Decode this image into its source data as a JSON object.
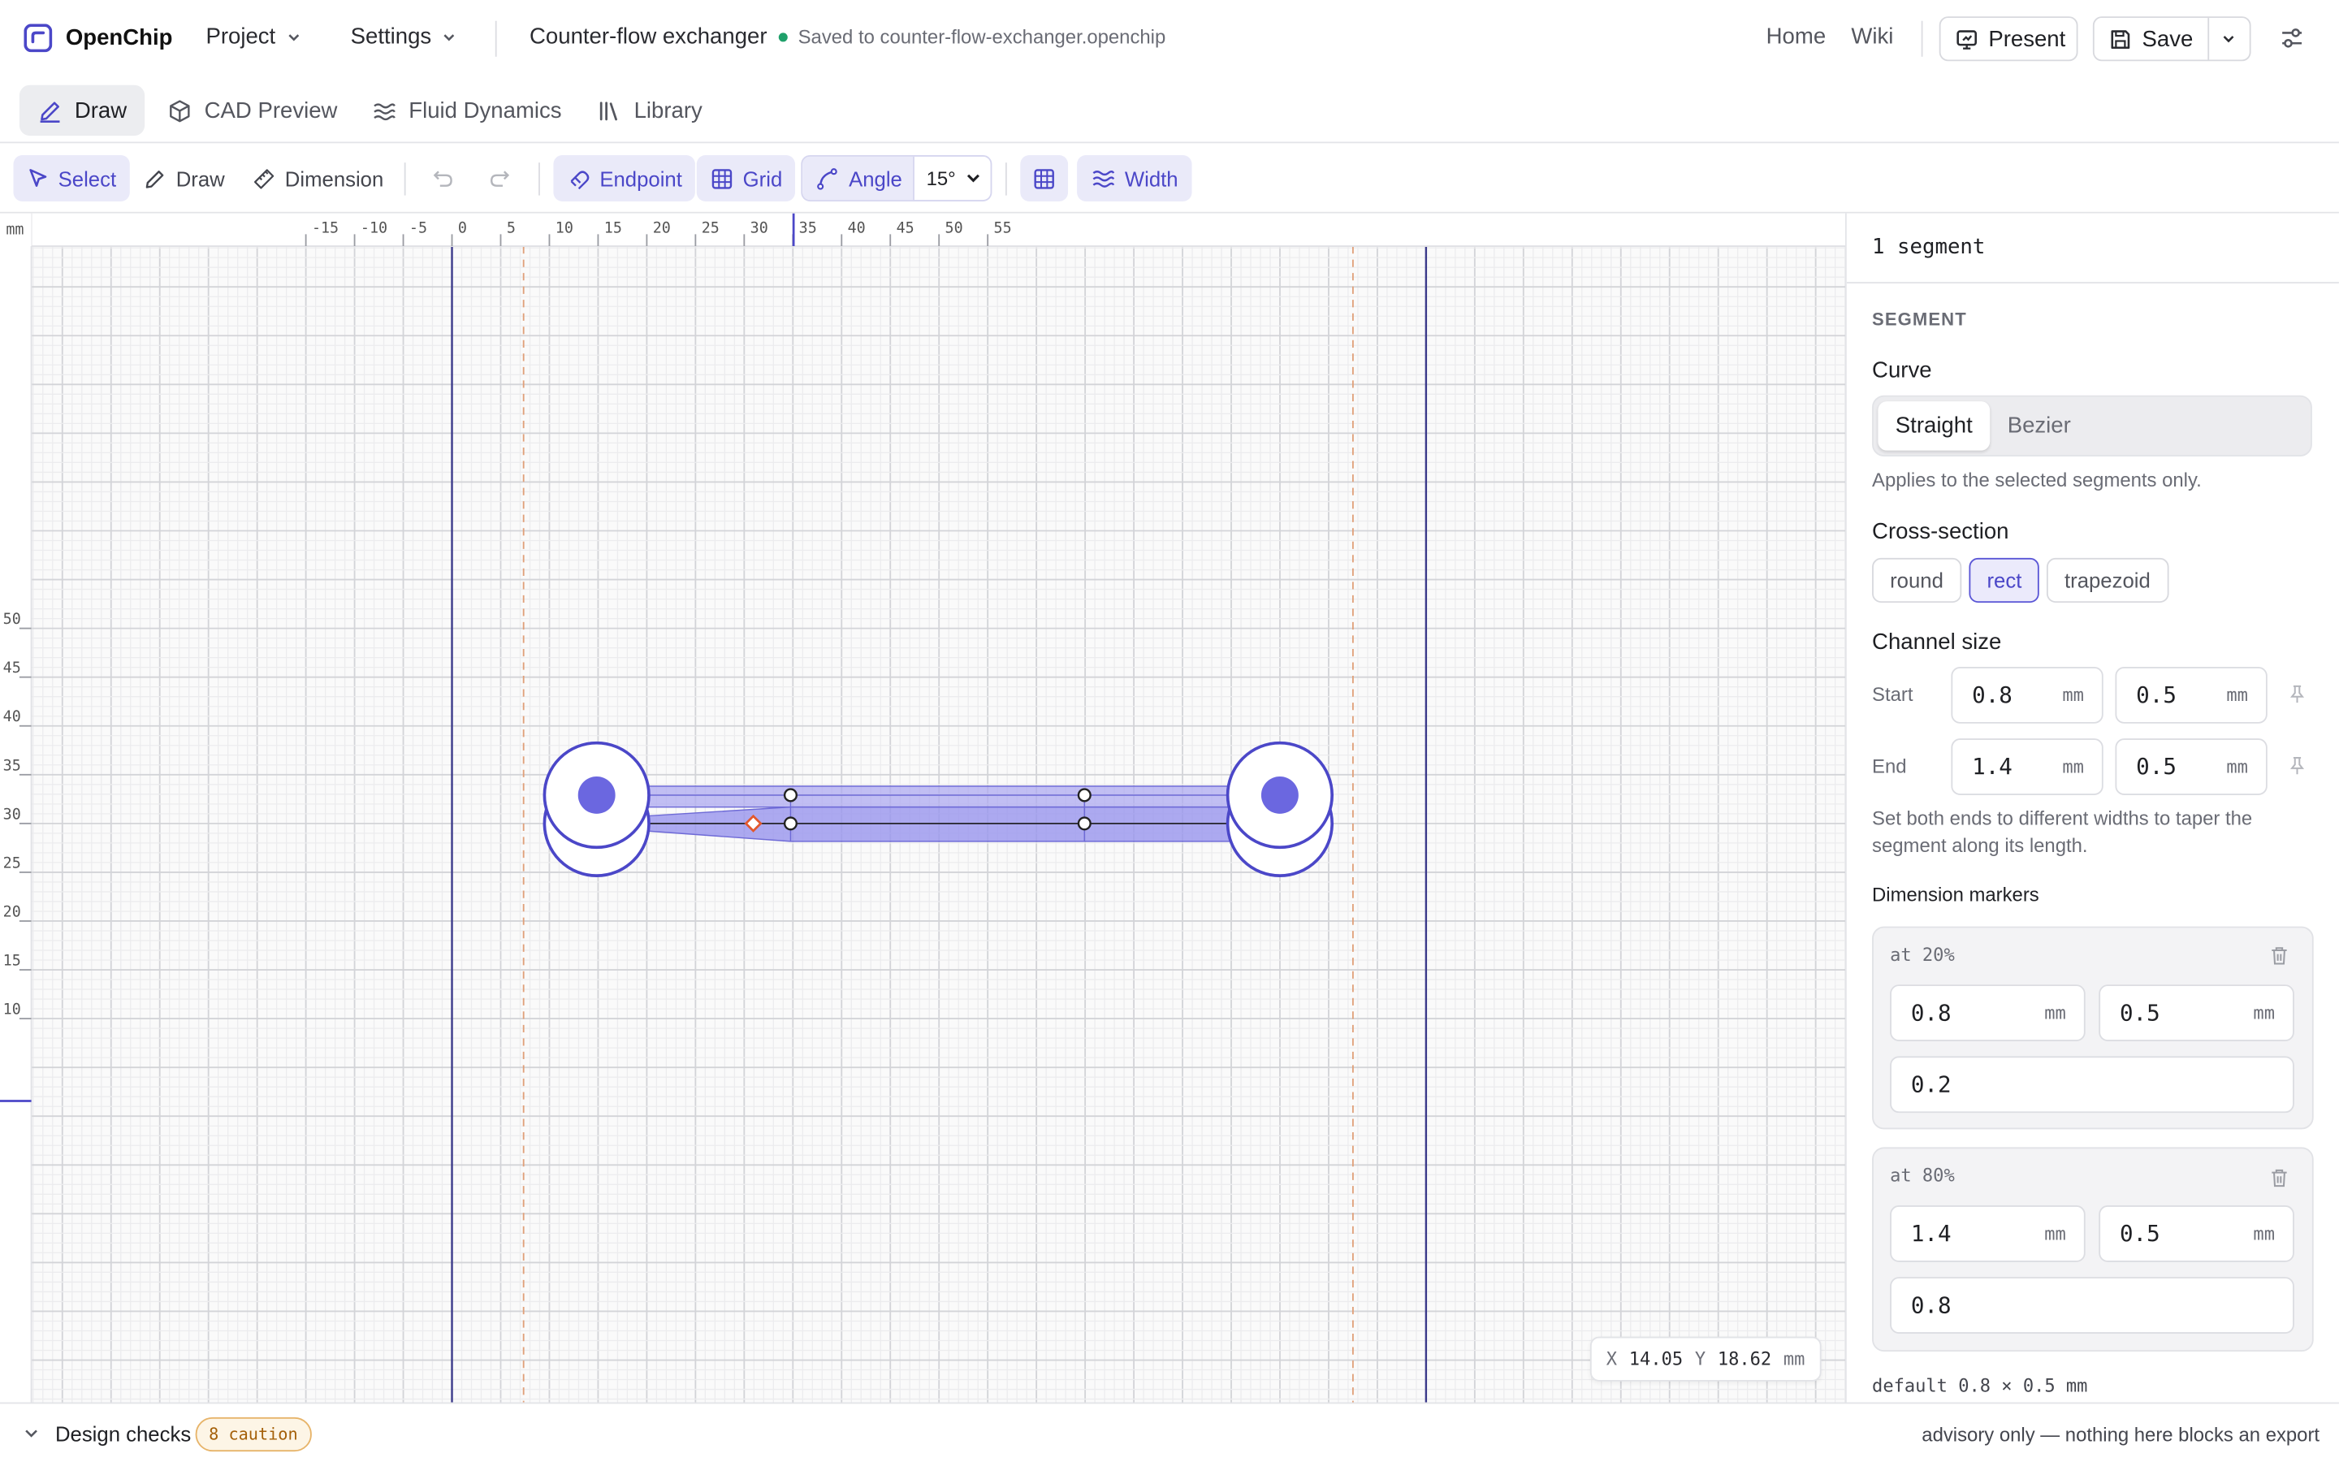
{
  "app": {
    "name": "OpenChip",
    "logo_icon": "openchip-logo-icon"
  },
  "topbar": {
    "project_label": "Project",
    "settings_label": "Settings",
    "document_title": "Counter-flow exchanger",
    "save_status": "Saved to counter-flow-exchanger.openchip",
    "status_color": "#1fa06a",
    "home_label": "Home",
    "wiki_label": "Wiki",
    "present_label": "Present",
    "save_label": "Save"
  },
  "tabs": [
    {
      "label": "Draw",
      "icon": "pencil-icon",
      "active": true
    },
    {
      "label": "CAD Preview",
      "icon": "cube-icon",
      "active": false
    },
    {
      "label": "Fluid Dynamics",
      "icon": "waves-icon",
      "active": false
    },
    {
      "label": "Library",
      "icon": "books-icon",
      "active": false
    }
  ],
  "toolbar": {
    "select_label": "Select",
    "draw_label": "Draw",
    "dimension_label": "Dimension",
    "endpoint_label": "Endpoint",
    "grid_label": "Grid",
    "angle_label": "Angle",
    "angle_value": "15°",
    "angle_options": [
      "15°"
    ],
    "width_label": "Width",
    "accent": "#4b47c8"
  },
  "canvas": {
    "unit_label": "mm",
    "x_ticks": [
      "-15",
      "-10",
      "-5",
      "0",
      "5",
      "10",
      "15",
      "20",
      "25",
      "30",
      "35",
      "40",
      "45",
      "50",
      "55"
    ],
    "y_ticks": [
      "50",
      "45",
      "40",
      "35",
      "30",
      "25",
      "20",
      "15",
      "10"
    ],
    "cursor": {
      "x_label": "X",
      "x_value": "14.05",
      "y_label": "Y",
      "y_value": "18.62",
      "unit": "mm"
    }
  },
  "panel": {
    "selection_summary": "1 segment",
    "section_title": "SEGMENT",
    "curve_label": "Curve",
    "curve_options": [
      "Straight",
      "Bezier"
    ],
    "curve_selected": "Straight",
    "curve_hint": "Applies to the selected segments only.",
    "cross_section_label": "Cross-section",
    "cross_sections": [
      "round",
      "rect",
      "trapezoid"
    ],
    "cross_section_selected": "rect",
    "channel_size_label": "Channel size",
    "start_label": "Start",
    "start_width": "0.8",
    "start_depth": "0.5",
    "end_label": "End",
    "end_width": "1.4",
    "end_depth": "0.5",
    "unit": "mm",
    "taper_hint": "Set both ends to different widths to taper the segment along its length.",
    "markers_label": "Dimension markers",
    "markers": [
      {
        "label": "at 20%",
        "width": "0.8",
        "depth": "0.5",
        "position": "0.2"
      },
      {
        "label": "at 80%",
        "width": "1.4",
        "depth": "0.5",
        "position": "0.8"
      }
    ],
    "default_note": "default 0.8 × 0.5 mm"
  },
  "footer": {
    "design_checks_label": "Design checks",
    "caution_badge": "8 caution",
    "advisory_note": "advisory only — nothing here blocks an export"
  }
}
